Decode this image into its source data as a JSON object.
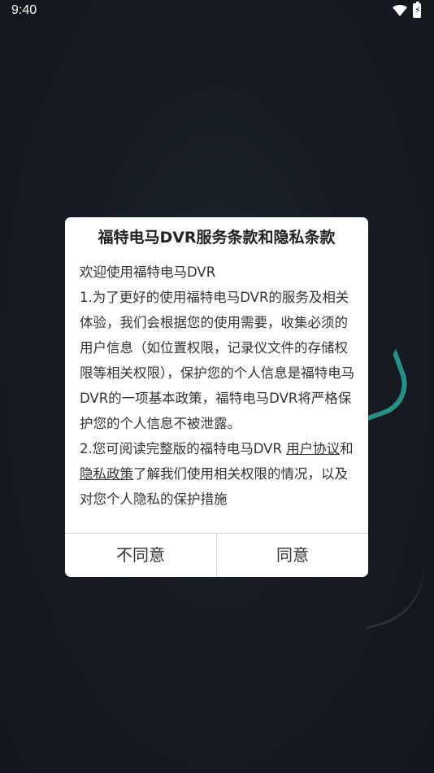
{
  "status_bar": {
    "time": "9:40"
  },
  "dialog": {
    "title": "福特电马DVR服务条款和隐私条款",
    "welcome": "欢迎使用福特电马DVR",
    "para1": "1.为了更好的使用福特电马DVR的服务及相关体验，我们会根据您的使用需要，收集必须的用户信息（如位置权限，记录仪文件的存储权限等相关权限），保护您的个人信息是福特电马DVR的一项基本政策，福特电马DVR将严格保护您的个人信息不被泄露。",
    "para2_prefix": "2.您可阅读完整版的福特电马DVR ",
    "user_agreement_link": "用户协议",
    "and_text": "和",
    "privacy_policy_link": "隐私政策",
    "para2_suffix": "了解我们使用相关权限的情况，以及对您个人隐私的保护措施",
    "disagree_label": "不同意",
    "agree_label": "同意"
  },
  "icons": {
    "wifi": "wifi-icon",
    "battery": "battery-charging-icon"
  },
  "colors": {
    "background": "#151a22",
    "dialog": "#ffffff",
    "accent_arc": "#2aa59a"
  }
}
